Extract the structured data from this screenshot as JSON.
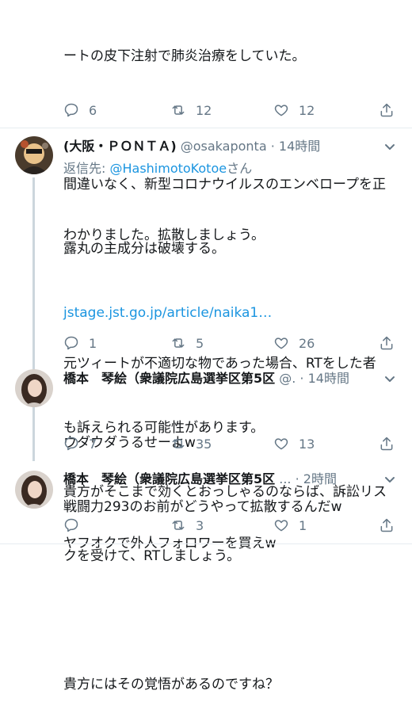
{
  "tweet0": {
    "lines": [
      "ートの皮下注射で肺炎治療をしていた。",
      "",
      "間違いなく、新型コロナウイルスのエンベロープを正",
      "露丸の主成分は破壊する。"
    ],
    "link": "jstage.jst.go.jp/article/naika1…",
    "replies": "6",
    "retweets": "12",
    "likes": "12"
  },
  "tweet1": {
    "name": "(大阪・ＰＯＮＴＡ)",
    "handle": "@osakaponta",
    "sep": "·",
    "time": "14時間",
    "reply_prefix": "返信先: ",
    "reply_to": "@HashimotoKotoe",
    "reply_suffix": "さん",
    "lines": [
      "わかりました。拡散しましょう。",
      "",
      "元ツィートが不適切な物であった場合、RTをした者",
      "も訴えられる可能性があります。",
      "貴方がそこまで効くとおっしゃるのならば、訴訟リス",
      "クを受けて、RTしましょう。",
      "",
      "貴方にはその覚悟があるのですね？"
    ],
    "replies": "1",
    "retweets": "5",
    "likes": "26"
  },
  "tweet2": {
    "name": "橋本　琴絵（衆議院広島選挙区第5区",
    "handle": "@.",
    "sep": "·",
    "time": "14時間",
    "lines": [
      "ウダウダうるせーよw",
      "戦闘力293のお前がどうやって拡散するんだw"
    ],
    "replies": "7",
    "retweets": "35",
    "likes": "13"
  },
  "tweet3": {
    "name": "橋本　琴絵（衆議院広島選挙区第5区",
    "handle": "...",
    "sep": "·",
    "time": "2時間",
    "lines": [
      "ヤフオクで外人フォロワーを買えw"
    ],
    "replies": "",
    "retweets": "3",
    "likes": "1"
  },
  "icons": [
    "reply-icon",
    "retweet-icon",
    "like-icon",
    "share-icon",
    "chevron-down-icon"
  ],
  "colors": {
    "link": "#1b95e0",
    "muted": "#657786",
    "divider": "#e6ecf0",
    "thread": "#ccd6dd"
  }
}
